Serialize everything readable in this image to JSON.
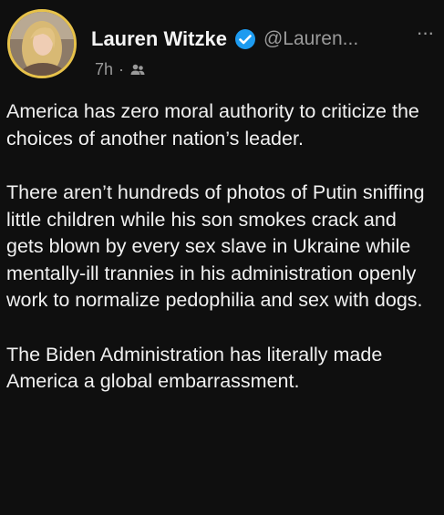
{
  "post": {
    "author": {
      "display_name": "Lauren Witzke",
      "handle": "@Lauren...",
      "verified": true,
      "avatar_icon": "profile-photo"
    },
    "timestamp": "7h",
    "separator": "·",
    "audience_icon": "friends-audience-icon",
    "more_icon": "more-horizontal-icon",
    "more_label": "···",
    "paragraphs": [
      "America has zero moral authority to criticize the choices of another nation’s leader.",
      "There aren’t hundreds of photos of Putin sniffing little children while his son smokes crack and gets blown by every sex slave in Ukraine while mentally-ill trannies in his administration openly work to normalize pedophilia and sex with dogs.",
      "The Biden Administration has literally made America a global embarrassment."
    ]
  },
  "colors": {
    "background": "#0f0f0f",
    "text": "#f1f1f1",
    "muted": "#9a9a9a",
    "verified_badge": "#1d9bf0",
    "avatar_ring": "#e7c24a"
  }
}
